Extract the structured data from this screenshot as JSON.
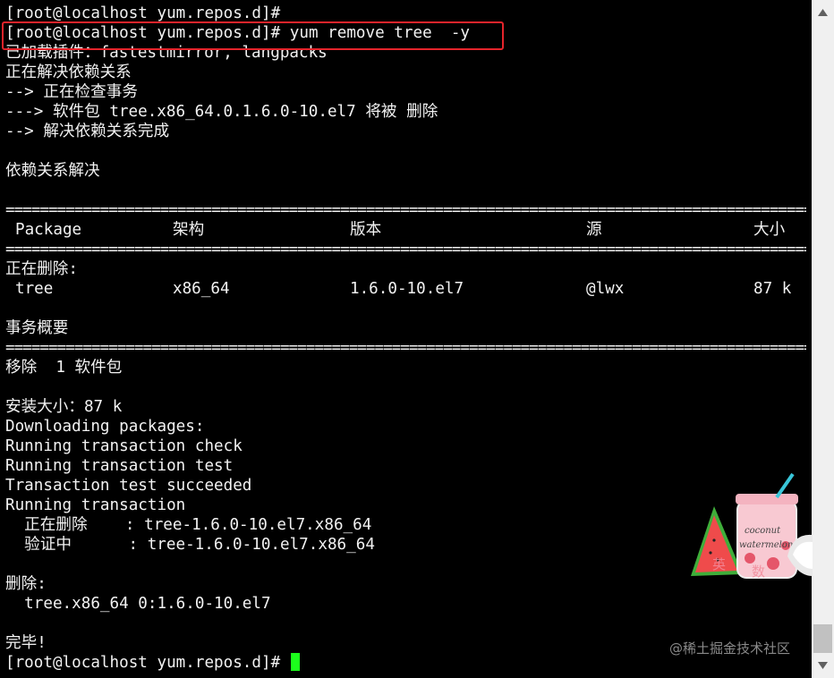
{
  "terminal": {
    "lines_top": [
      "[root@localhost yum.repos.d]#",
      "[root@localhost yum.repos.d]# yum remove tree  -y",
      "已加载插件：fastestmirror, langpacks",
      "正在解决依赖关系",
      "--> 正在检查事务",
      "---> 软件包 tree.x86_64.0.1.6.0-10.el7 将被 删除",
      "--> 解决依赖关系完成",
      "",
      "依赖关系解决",
      ""
    ],
    "separator": "================================================================================================",
    "table_header": {
      "package": "Package",
      "arch": "架构",
      "version": "版本",
      "repo": "源",
      "size": "大小"
    },
    "removing_label": "正在删除:",
    "table_row": {
      "package": "tree",
      "arch": "x86_64",
      "version": "1.6.0-10.el7",
      "repo": "@lwx",
      "size": "87 k"
    },
    "summary_title": "事务概要",
    "lines_bottom": [
      "移除  1 软件包",
      "",
      "安装大小：87 k",
      "Downloading packages:",
      "Running transaction check",
      "Running transaction test",
      "Transaction test succeeded",
      "Running transaction",
      "  正在删除    : tree-1.6.0-10.el7.x86_64",
      "  验证中      : tree-1.6.0-10.el7.x86_64",
      "",
      "删除:",
      "  tree.x86_64 0:1.6.0-10.el7",
      "",
      "完毕!"
    ],
    "prompt": "[root@localhost yum.repos.d]#",
    "cursor_color": "#1cff1c",
    "highlight_color": "#e5242b"
  },
  "scrollbar": {
    "up_icon": "triangle-up-icon",
    "down_icon": "triangle-down-icon"
  },
  "sticker": {
    "text_top": "coconut",
    "text_bottom": "watermelon",
    "badge_1": "英",
    "badge_2": "数"
  },
  "watermark": "@稀土掘金技术社区"
}
